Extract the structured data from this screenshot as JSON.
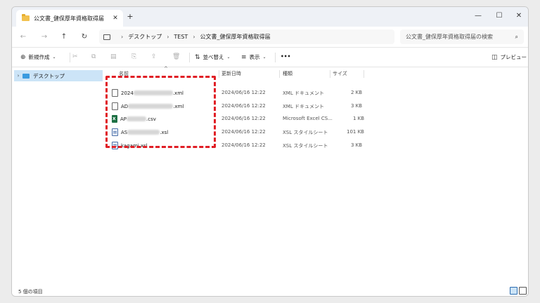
{
  "window": {
    "tab_title": "公文書_健保厚年資格取得届",
    "tab_close": "✕",
    "new_tab": "+",
    "controls": {
      "minimize": "—",
      "maximize": "☐",
      "close": "✕"
    }
  },
  "nav": {
    "back": "←",
    "forward": "→",
    "up": "↑",
    "refresh": "↻",
    "breadcrumb": [
      "デスクトップ",
      "TEST",
      "公文書_健保厚年資格取得届"
    ],
    "search_placeholder": "公文書_健保厚年資格取得届の検索"
  },
  "toolbar": {
    "new_label": "新規作成",
    "sort_label": "並べ替え",
    "view_label": "表示",
    "more_label": "•••",
    "preview_label": "プレビュー"
  },
  "sidebar": {
    "items": [
      {
        "label": "デスクトップ"
      }
    ]
  },
  "file_list": {
    "columns": [
      "名前",
      "更新日時",
      "種類",
      "サイズ"
    ],
    "rows": [
      {
        "name_prefix": "2024",
        "name_suffix": ".xml",
        "modified": "2024/06/16 12:22",
        "type": "XML ドキュメント",
        "size": "2 KB",
        "icon": "xml-file-icon"
      },
      {
        "name_prefix": "AD",
        "name_suffix": ".xml",
        "modified": "2024/06/16 12:22",
        "type": "XML ドキュメント",
        "size": "3 KB",
        "icon": "xml-file-icon"
      },
      {
        "name_prefix": "AP",
        "name_suffix": ".csv",
        "modified": "2024/06/16 12:22",
        "type": "Microsoft Excel CS...",
        "size": "1 KB",
        "icon": "excel-csv-icon"
      },
      {
        "name_prefix": "AS",
        "name_suffix": ".xsl",
        "modified": "2024/06/16 12:22",
        "type": "XSL スタイルシート",
        "size": "101 KB",
        "icon": "xsl-file-icon"
      },
      {
        "name_prefix": "kagami.xsl",
        "name_suffix": "",
        "modified": "2024/06/16 12:22",
        "type": "XSL スタイルシート",
        "size": "3 KB",
        "icon": "xsl-file-icon"
      }
    ]
  },
  "status": {
    "item_count": "5 個の項目"
  },
  "colors": {
    "highlight": "#e01e25",
    "selection": "#cce4f7",
    "accent": "#2b6cb0"
  }
}
